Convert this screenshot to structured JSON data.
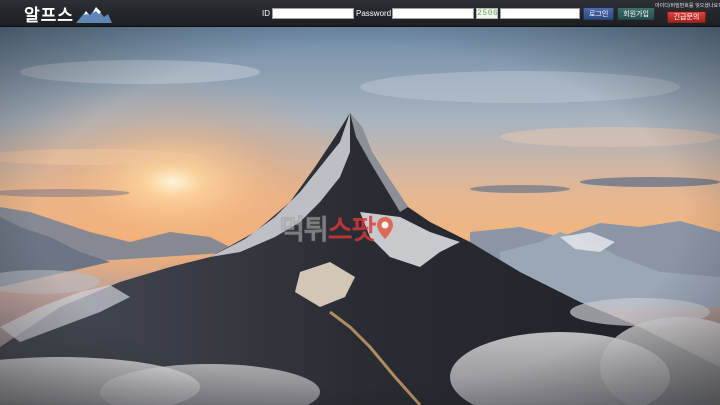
{
  "header": {
    "logo_text": "알프스",
    "login": {
      "id_label": "ID",
      "id_value": "",
      "password_label": "Password",
      "password_value": "",
      "captcha_code": "2506",
      "captcha_input_value": "",
      "login_button": "로그인",
      "join_button": "회원가입",
      "phone_notice": "아이디/비밀번호를 잊으셨나요?",
      "emergency_button": "긴급문의"
    }
  },
  "hero": {
    "watermark_part1": "먹튀",
    "watermark_part2": "스팟",
    "pin_icon": "map-pin-icon"
  },
  "colors": {
    "topbar": "#232529",
    "login_button": "#3c5794",
    "join_button": "#2f5e5c",
    "emergency_button": "#c3302a",
    "watermark_accent": "#d9393a"
  }
}
